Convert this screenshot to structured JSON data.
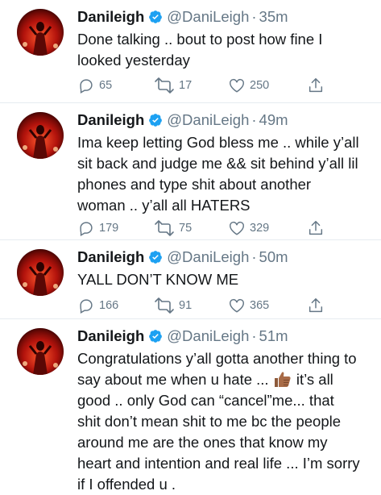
{
  "tweets": [
    {
      "name": "Danileigh",
      "handle": "@DaniLeigh",
      "separator": "·",
      "time": "35m",
      "lines": [
        "Done talking .. bout to post how fine I",
        "looked yesterday"
      ],
      "replies": "65",
      "retweets": "17",
      "likes": "250"
    },
    {
      "name": "Danileigh",
      "handle": "@DaniLeigh",
      "separator": "·",
      "time": "49m",
      "lines": [
        "Ima keep letting God bless me .. while y’all",
        "sit back and judge me && sit behind y’all lil",
        "phones and type shit about another",
        "woman .. y’all all HATERS"
      ],
      "replies": "179",
      "retweets": "75",
      "likes": "329"
    },
    {
      "name": "Danileigh",
      "handle": "@DaniLeigh",
      "separator": "·",
      "time": "50m",
      "lines": [
        "YALL DON’T KNOW ME"
      ],
      "replies": "166",
      "retweets": "91",
      "likes": "365"
    },
    {
      "name": "Danileigh",
      "handle": "@DaniLeigh",
      "separator": "·",
      "time": "51m",
      "lines": [
        "Congratulations y’all gotta another thing to",
        "say about me when u hate ...",
        "it’s all",
        "good ..  only God can “cancel”me... that",
        "shit don’t mean shit to me bc the people",
        "around me are the ones that know my",
        "heart and intention and real life ... I’m sorry",
        "if I offended u ."
      ],
      "emoji": "thumbs-up-icon"
    }
  ],
  "colors": {
    "verified": "#1da1f2",
    "secondary_text": "#657786",
    "avatar_red": "#b3130c"
  }
}
